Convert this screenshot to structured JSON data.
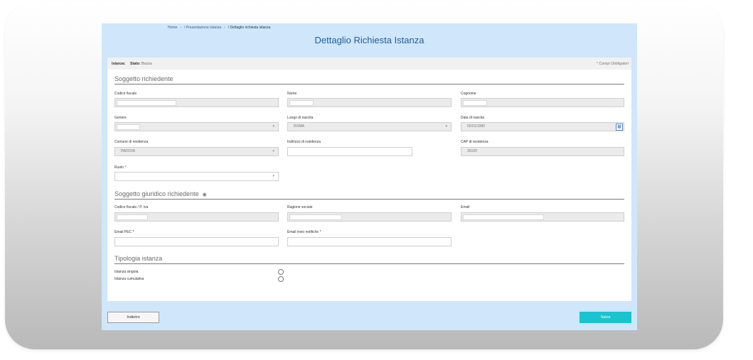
{
  "breadcrumb": {
    "home": "Home",
    "sep": "›",
    "step1": "/ Presentazione istanza",
    "current": "/ Dettaglio richiesta istanza"
  },
  "page_title": "Dettaglio Richiesta Istanza",
  "status_bar": {
    "istanza_label": "Istanza:",
    "stato_label": "Stato:",
    "stato_value": "Bozza",
    "required_note": "* Campi Obbligatori"
  },
  "soggetto_richiedente": {
    "title": "Soggetto richiedente",
    "codice_fiscale": {
      "label": "Codice fiscale",
      "value": ""
    },
    "nome": {
      "label": "Nome",
      "value": ""
    },
    "cognome": {
      "label": "Cognome",
      "value": ""
    },
    "genere": {
      "label": "Genere",
      "value": ""
    },
    "luogo_nascita": {
      "label": "Luogo di nascita",
      "value": "ROMA"
    },
    "data_nascita": {
      "label": "Data di nascita",
      "value": "02/01/1980"
    },
    "comune_residenza": {
      "label": "Comune di residenza",
      "value": "PADOVA"
    },
    "indirizzo_residenza": {
      "label": "Indirizzo di residenza",
      "value": ""
    },
    "cap_residenza": {
      "label": "CAP di residenza",
      "value": "35100"
    },
    "ruolo": {
      "label": "Ruolo *",
      "value": ""
    }
  },
  "soggetto_giuridico": {
    "title": "Soggetto giuridico richiedente",
    "codice_fiscale_piva": {
      "label": "Codice fiscale / P. Iva",
      "value": ""
    },
    "ragione_sociale": {
      "label": "Ragione sociale",
      "value": ""
    },
    "email": {
      "label": "Email",
      "value": ""
    },
    "email_pec": {
      "label": "Email PEC *",
      "value": ""
    },
    "email_notifiche": {
      "label": "Email invio notifiche *",
      "value": ""
    }
  },
  "tipologia_istanza": {
    "title": "Tipologia istanza",
    "options": [
      "Istanza singola",
      "Istanza cumulativa"
    ]
  },
  "buttons": {
    "back": "Indietro",
    "save": "Salva"
  },
  "icons": {
    "caret": "▾",
    "calendar": "▦",
    "eye": "◉"
  },
  "colors": {
    "panel": "#cfe6fb",
    "title": "#1f5e9b",
    "save": "#19c3cf"
  }
}
